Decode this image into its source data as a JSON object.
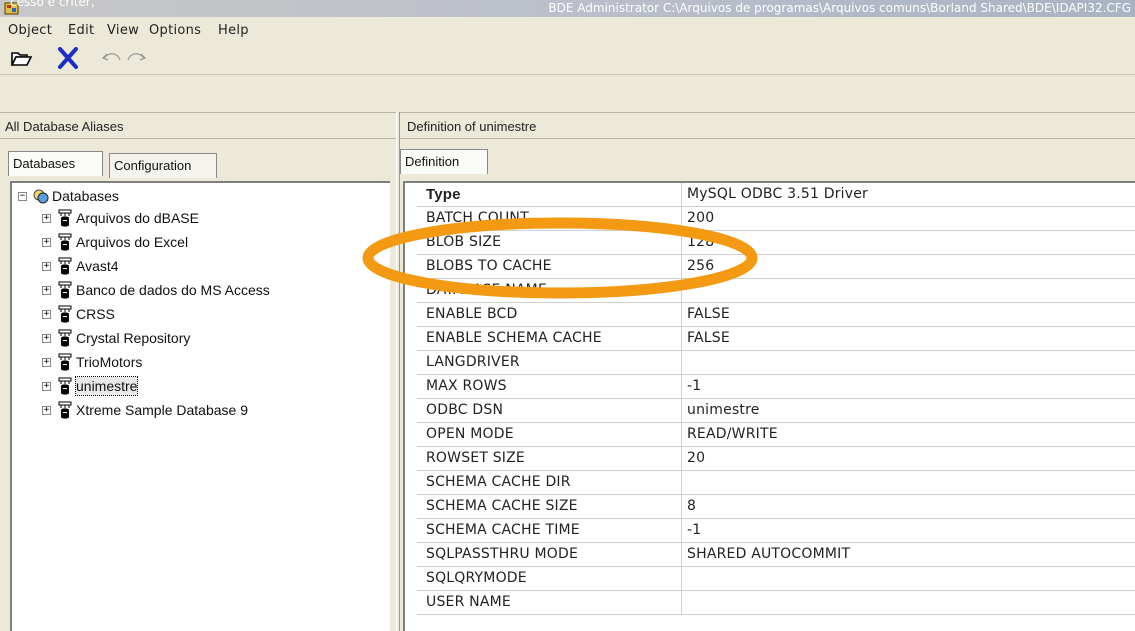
{
  "window": {
    "caption_fragment": "cesso e criter,",
    "title": "BDE Administrator  C:\\Arquivos de programas\\Arquivos comuns\\Borland Shared\\BDE\\IDAPI32.CFG"
  },
  "menu": [
    "Object",
    "Edit",
    "View",
    "Options",
    "Help"
  ],
  "toolbar": {
    "icons": [
      "open-folder-icon",
      "delete-x-icon",
      "undo-icon",
      "redo-icon"
    ]
  },
  "left_panel": {
    "header": "All Database Aliases",
    "tabs": [
      "Databases",
      "Configuration"
    ],
    "tree_root": "Databases",
    "items": [
      "Arquivos do dBASE",
      "Arquivos do Excel",
      "Avast4",
      "Banco de dados do MS Access",
      "CRSS",
      "Crystal Repository",
      "TrioMotors",
      "unimestre",
      "Xtreme Sample Database 9"
    ],
    "selected": "unimestre"
  },
  "right_panel": {
    "header": "Definition of unimestre",
    "tab": "Definition",
    "rows": [
      {
        "name": "Type",
        "value": "MySQL ODBC 3.51 Driver"
      },
      {
        "name": "BATCH COUNT",
        "value": "200"
      },
      {
        "name": "BLOB SIZE",
        "value": "128"
      },
      {
        "name": "BLOBS TO CACHE",
        "value": "256"
      },
      {
        "name": "DATABASE NAME",
        "value": ""
      },
      {
        "name": "ENABLE BCD",
        "value": "FALSE"
      },
      {
        "name": "ENABLE SCHEMA CACHE",
        "value": "FALSE"
      },
      {
        "name": "LANGDRIVER",
        "value": ""
      },
      {
        "name": "MAX ROWS",
        "value": "-1"
      },
      {
        "name": "ODBC DSN",
        "value": "unimestre"
      },
      {
        "name": "OPEN MODE",
        "value": "READ/WRITE"
      },
      {
        "name": "ROWSET SIZE",
        "value": "20"
      },
      {
        "name": "SCHEMA CACHE DIR",
        "value": ""
      },
      {
        "name": "SCHEMA CACHE SIZE",
        "value": "8"
      },
      {
        "name": "SCHEMA CACHE TIME",
        "value": "-1"
      },
      {
        "name": "SQLPASSTHRU MODE",
        "value": "SHARED AUTOCOMMIT"
      },
      {
        "name": "SQLQRYMODE",
        "value": ""
      },
      {
        "name": "USER NAME",
        "value": ""
      }
    ]
  },
  "colors": {
    "annotation": "#f39a12",
    "face": "#ece9d8",
    "selection_outline": "#000000"
  }
}
